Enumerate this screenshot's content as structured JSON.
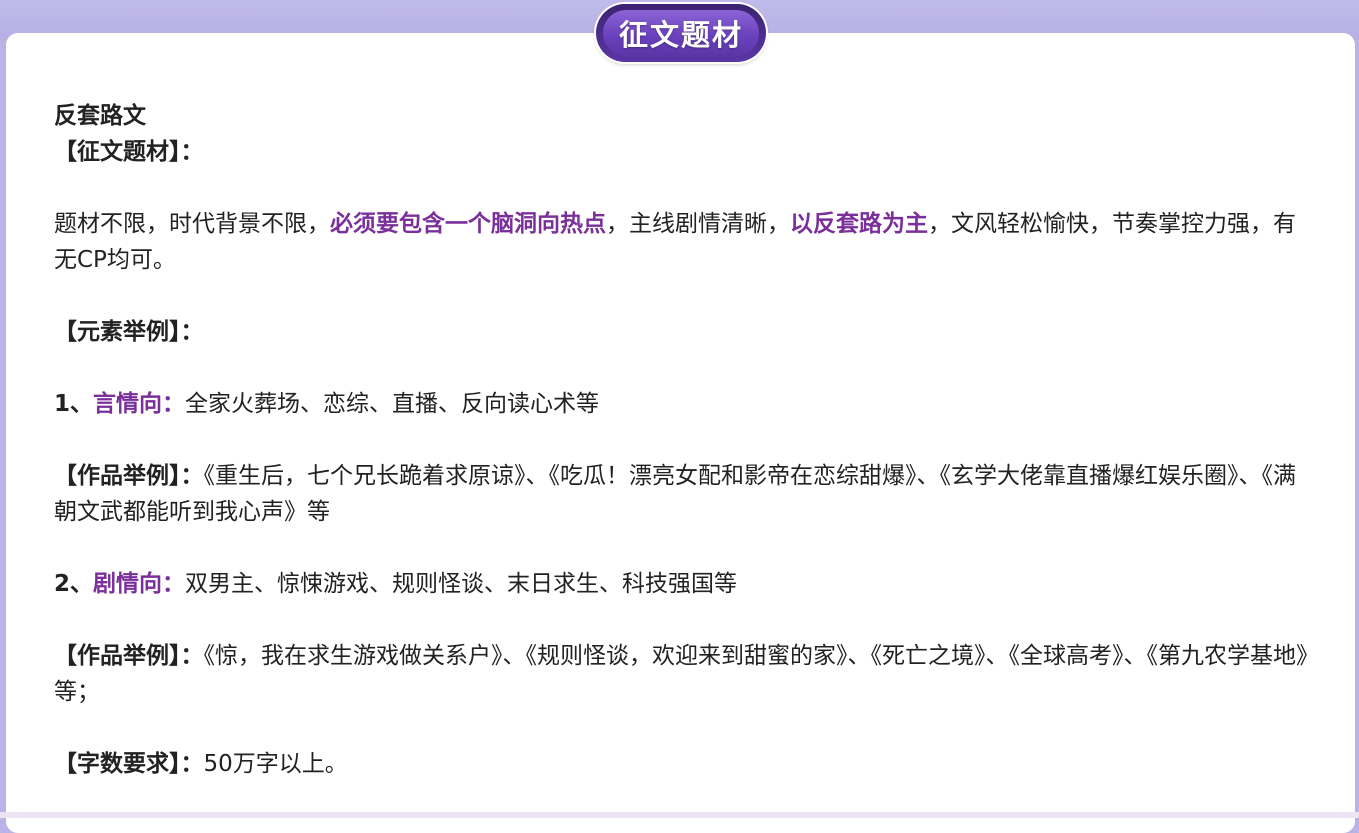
{
  "header": {
    "badge_title": "征文题材"
  },
  "article": {
    "title": "反套路文",
    "topic_label": "【征文题材】：",
    "intro": {
      "p1": "题材不限，时代背景不限，",
      "h1": "必须要包含一个脑洞向热点",
      "p2": "，主线剧情清晰，",
      "h2": "以反套路为主",
      "p3": "，文风轻松愉快，节奏掌控力强，有无CP均可。"
    },
    "elements_label": "【元素举例】：",
    "item1": {
      "num": "1、",
      "name": "言情向：",
      "text": "全家火葬场、恋综、直播、反向读心术等"
    },
    "works1": {
      "label": "【作品举例】：",
      "text": "《重生后，七个兄长跪着求原谅》、《吃瓜！漂亮女配和影帝在恋综甜爆》、《玄学大佬靠直播爆红娱乐圈》、《满朝文武都能听到我心声》等"
    },
    "item2": {
      "num": "2、",
      "name": "剧情向：",
      "text": "双男主、惊悚游戏、规则怪谈、末日求生、科技强国等"
    },
    "works2": {
      "label": "【作品举例】：",
      "text": "《惊，我在求生游戏做关系户》、《规则怪谈，欢迎来到甜蜜的家》、《死亡之境》、《全球高考》、《第九农学基地》等；"
    },
    "wordcount": {
      "label": "【字数要求】：",
      "text": "50万字以上。"
    }
  },
  "colors": {
    "background": "#b9b3e6",
    "highlight": "#7a2f9b",
    "badge": "#6b42bd"
  }
}
